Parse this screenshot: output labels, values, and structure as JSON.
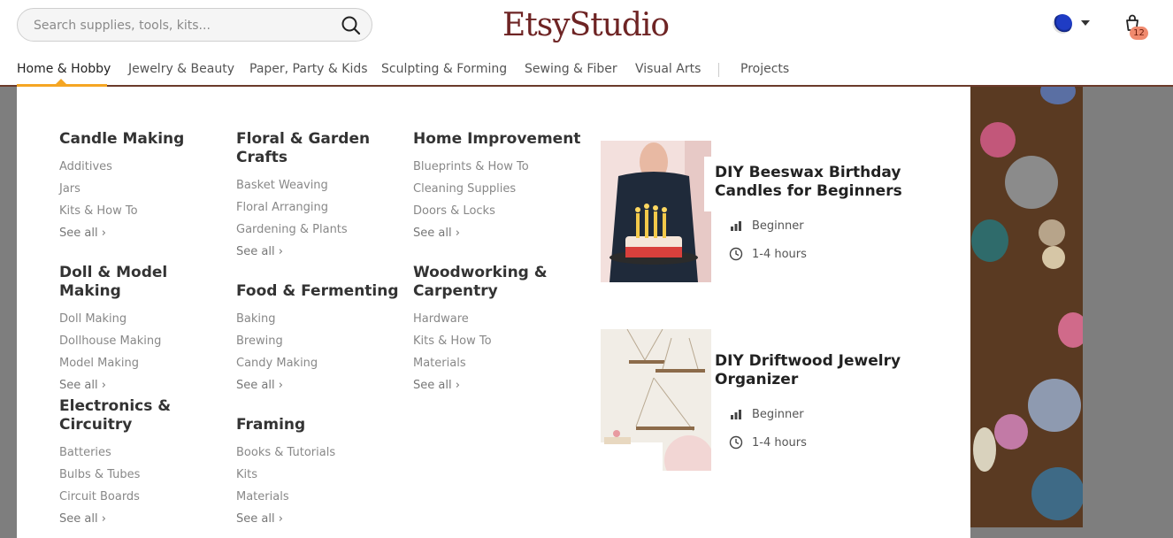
{
  "search": {
    "placeholder": "Search supplies, tools, kits..."
  },
  "brand": {
    "logo": "EtsyStudio",
    "color": "#6e2424"
  },
  "cart": {
    "count": "12"
  },
  "nav": {
    "items": [
      {
        "label": "Home & Hobby",
        "active": true
      },
      {
        "label": "Jewelry & Beauty"
      },
      {
        "label": "Paper, Party & Kids"
      },
      {
        "label": "Sculpting & Forming"
      },
      {
        "label": "Sewing & Fiber"
      },
      {
        "label": "Visual Arts"
      },
      {
        "label": "Projects"
      }
    ],
    "accent": "#f5a623"
  },
  "menu": {
    "see_all": "See all",
    "groups": [
      {
        "title": "Candle Making",
        "links": [
          "Additives",
          "Jars",
          "Kits & How To"
        ]
      },
      {
        "title": "Doll & Model Making",
        "links": [
          "Doll Making",
          "Dollhouse Making",
          "Model Making"
        ]
      },
      {
        "title": "Electronics & Circuitry",
        "links": [
          "Batteries",
          "Bulbs & Tubes",
          "Circuit Boards"
        ]
      },
      {
        "title": "Floral & Garden Crafts",
        "links": [
          "Basket Weaving",
          "Floral Arranging",
          "Gardening & Plants"
        ]
      },
      {
        "title": "Food & Fermenting",
        "links": [
          "Baking",
          "Brewing",
          "Candy Making"
        ]
      },
      {
        "title": "Framing",
        "links": [
          "Books & Tutorials",
          "Kits",
          "Materials"
        ]
      },
      {
        "title": "Home Improvement",
        "links": [
          "Blueprints & How To",
          "Cleaning Supplies",
          "Doors & Locks"
        ]
      },
      {
        "title": "Woodworking & Carpentry",
        "links": [
          "Hardware",
          "Kits & How To",
          "Materials"
        ]
      }
    ]
  },
  "projects": [
    {
      "title": "DIY Beeswax Birthday Candles for Beginners",
      "level": "Beginner",
      "time": "1-4 hours"
    },
    {
      "title": "DIY Driftwood Jewelry Organizer",
      "level": "Beginner",
      "time": "1-4 hours"
    }
  ]
}
